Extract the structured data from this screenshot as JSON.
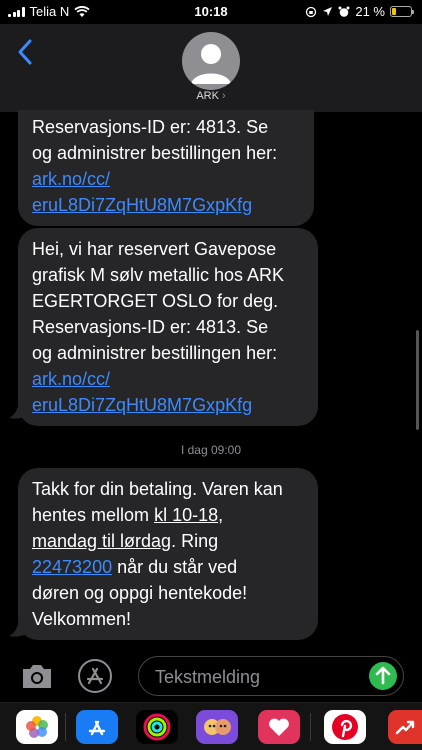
{
  "status_bar": {
    "carrier": "Telia N",
    "time": "10:18",
    "battery_percent_label": "21 %",
    "battery_level": 0.21,
    "icons": [
      "signal-icon",
      "wifi-icon",
      "screen-lock-icon",
      "location-icon",
      "alarm-icon",
      "battery-icon"
    ]
  },
  "header": {
    "contact_name": "ARK",
    "chevron": "›"
  },
  "messages": [
    {
      "lines": [
        "Reservasjons-ID er: 4813. Se",
        "og administrer bestillingen her:"
      ],
      "link_lines": [
        "ark.no/cc/",
        "eruL8Di7ZqHtU8M7GxpKfg"
      ]
    },
    {
      "lines": [
        "Hei, vi har reservert Gavepose",
        "grafisk M sølv metallic hos ARK",
        "EGERTORGET OSLO for deg.",
        "Reservasjons-ID er: 4813. Se",
        "og administrer bestillingen her:"
      ],
      "link_lines": [
        "ark.no/cc/",
        "eruL8Di7ZqHtU8M7GxpKfg"
      ]
    }
  ],
  "timestamp": "I dag 09:00",
  "last_message": {
    "l1": "Takk for din betaling. Varen kan",
    "l2_pre": "hentes mellom ",
    "l2_u": "kl 10-18",
    "l2_post": ",",
    "l3_u": "mandag til lørdag",
    "l3_post": ". Ring",
    "l4_link": "22473200",
    "l4_post": " når du står ved",
    "l5": "døren og oppgi hentekode!",
    "l6": "Velkommen!"
  },
  "composer": {
    "placeholder": "Tekstmelding"
  },
  "app_drawer": [
    "photos-app-icon",
    "app-store-icon",
    "activity-app-icon",
    "memoji-app-icon",
    "heart-app-icon",
    "pinterest-app-icon",
    "trending-app-icon"
  ]
}
